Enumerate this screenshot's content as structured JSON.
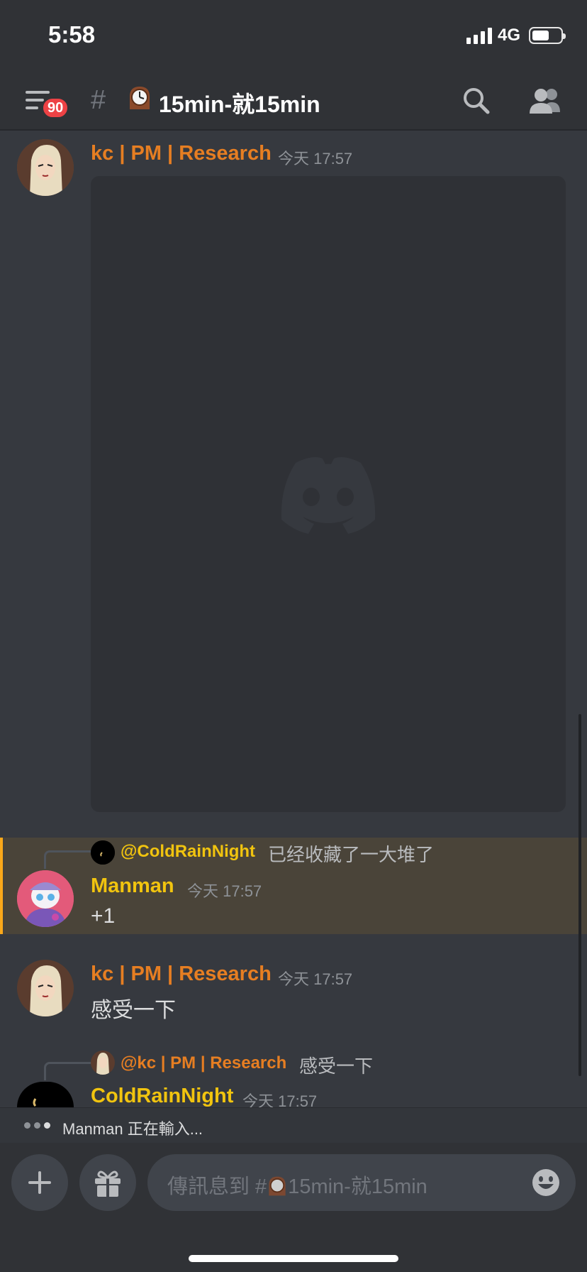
{
  "status_bar": {
    "time": "5:58",
    "network": "4G",
    "battery_level": 0.6
  },
  "header": {
    "menu_icon": "menu-icon",
    "unread_badge": "90",
    "hash_glyph": "#",
    "channel_emoji": "mantelpiece-clock",
    "channel_name": "15min-就15min",
    "search_icon": "search-icon",
    "members_icon": "members-icon"
  },
  "messages": [
    {
      "author": "kc | PM | Research",
      "author_color": "#e67e22",
      "timestamp": "今天 17:57",
      "attachment": "image-embed-placeholder"
    },
    {
      "highlighted": true,
      "reply_to": {
        "author": "@ColdRainNight",
        "author_color": "#f1c40f",
        "text": "已经收藏了一大堆了"
      },
      "author": "Manman",
      "author_color": "#f1c40f",
      "timestamp": "今天 17:57",
      "text": "+1"
    },
    {
      "author": "kc | PM | Research",
      "author_color": "#e67e22",
      "timestamp": "今天 17:57",
      "text": "感受一下"
    },
    {
      "reply_to": {
        "author": "@kc | PM | Research",
        "author_color": "#e67e22",
        "text": "感受一下"
      },
      "author": "ColdRainNight",
      "author_color": "#f1c40f",
      "timestamp": "今天 17:57"
    }
  ],
  "typing": {
    "text": "Manman 正在輸入..."
  },
  "composer": {
    "add_icon": "plus-icon",
    "gift_icon": "gift-icon",
    "placeholder_prefix": "傳訊息到 #",
    "placeholder_channel": "15min-就15min",
    "emoji_icon": "emoji-icon"
  },
  "colors": {
    "background": "#36393f",
    "header": "#303236",
    "highlight": "#4a4439",
    "highlight_bar": "#faa81a",
    "badge": "#ed4245"
  }
}
